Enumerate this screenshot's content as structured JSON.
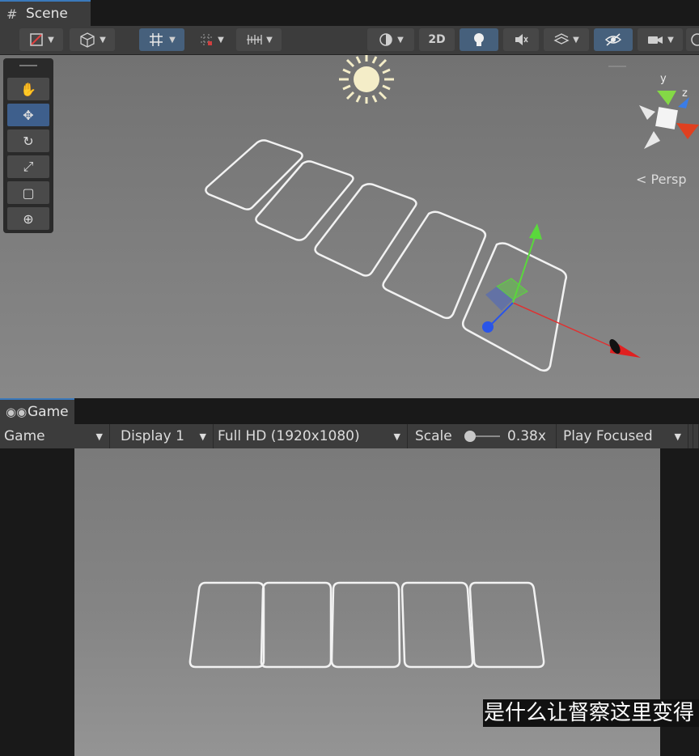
{
  "scene_tab": {
    "icon": "grid-icon",
    "title": "Scene"
  },
  "scene_toolbar": {
    "btn_2d": "2D"
  },
  "tools": [
    "hand-tool-icon",
    "move-tool-icon",
    "rotate-tool-icon",
    "scale-tool-icon",
    "rect-tool-icon",
    "transform-tool-icon"
  ],
  "gizmo": {
    "y": "y",
    "z": "z",
    "projection": "< Persp"
  },
  "game_tab": {
    "icon": "gamepad-icon",
    "title": "Game"
  },
  "game_toolbar": {
    "view": "Game",
    "display": "Display 1",
    "resolution": "Full HD (1920x1080)",
    "scale_label": "Scale",
    "scale_value": "0.38x",
    "play_mode": "Play Focused"
  },
  "subtitle": "是什么让督察这里变得",
  "colors": {
    "accent": "#3a79bb",
    "x_axis": "#e03030",
    "y_axis": "#5ad83c",
    "z_axis": "#2a55e8"
  }
}
